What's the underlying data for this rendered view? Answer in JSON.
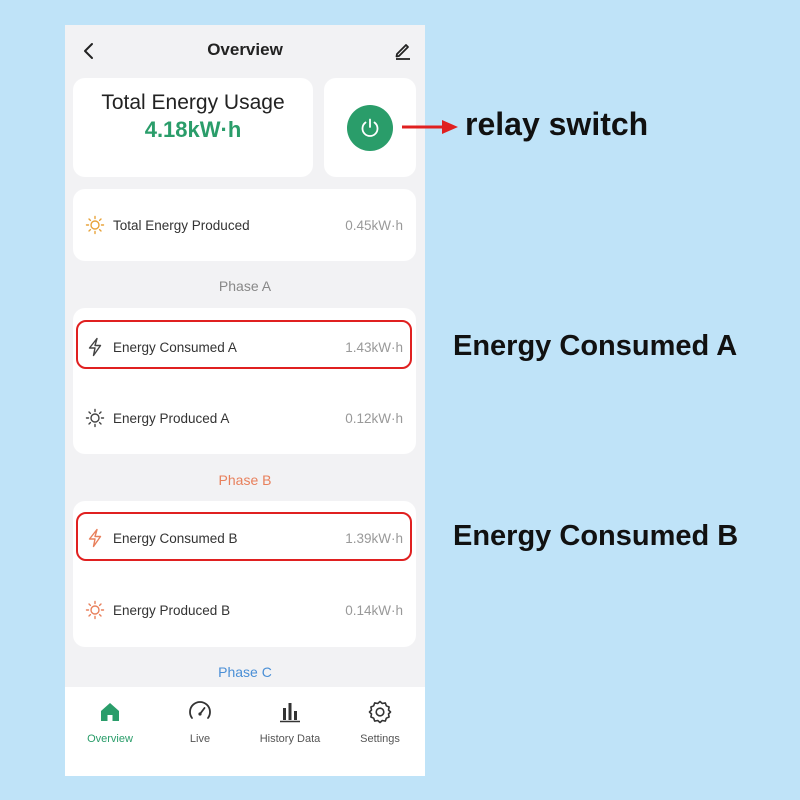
{
  "header": {
    "title": "Overview"
  },
  "summary": {
    "total_label": "Total Energy Usage",
    "total_value": "4.18kW·h"
  },
  "produced_total": {
    "label": "Total Energy Produced",
    "value": "0.45kW·h"
  },
  "phases": {
    "a": {
      "label": "Phase A",
      "color": "#888888",
      "consumed": {
        "label": "Energy Consumed A",
        "value": "1.43kW·h"
      },
      "produced": {
        "label": "Energy Produced A",
        "value": "0.12kW·h"
      }
    },
    "b": {
      "label": "Phase B",
      "color": "#e8805c",
      "consumed": {
        "label": "Energy Consumed B",
        "value": "1.39kW·h"
      },
      "produced": {
        "label": "Energy Produced B",
        "value": "0.14kW·h"
      }
    },
    "c": {
      "label": "Phase C",
      "color": "#4a8fd6"
    }
  },
  "nav": {
    "items": [
      {
        "label": "Overview",
        "icon": "home-icon",
        "active": true
      },
      {
        "label": "Live",
        "icon": "gauge-icon"
      },
      {
        "label": "History Data",
        "icon": "bar-chart-icon"
      },
      {
        "label": "Settings",
        "icon": "gear-icon"
      }
    ]
  },
  "annotations": {
    "relay": "relay switch",
    "consumed_a": "Energy Consumed A",
    "consumed_b": "Energy Consumed B"
  },
  "colors": {
    "accent": "#2a9d6a",
    "highlight": "#e02020",
    "sun": "#e8a33a"
  }
}
